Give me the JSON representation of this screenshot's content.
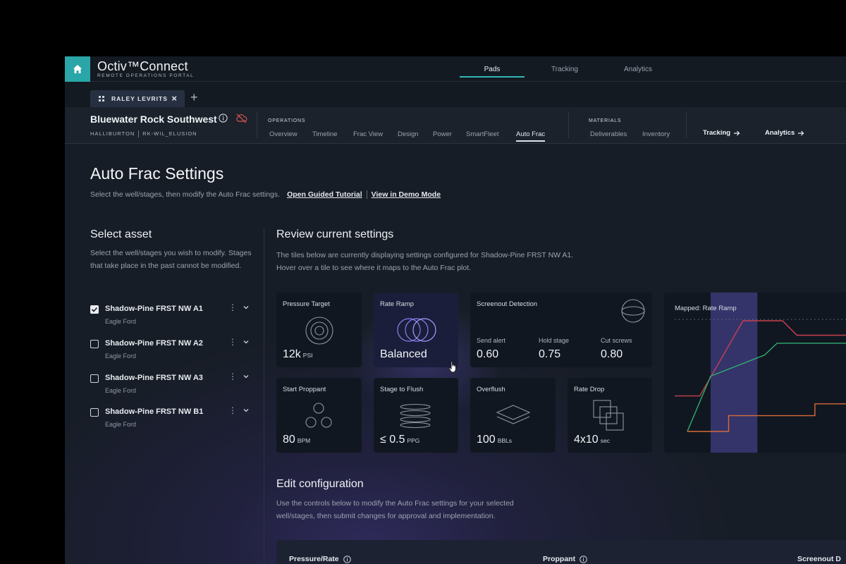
{
  "app": {
    "brand_name": "Octiv™Connect",
    "brand_sub": "REMOTE OPERATIONS PORTAL",
    "nav_tabs": [
      {
        "label": "Pads",
        "active": true
      },
      {
        "label": "Tracking",
        "active": false
      },
      {
        "label": "Analytics",
        "active": false
      }
    ]
  },
  "tabs": {
    "open_tab": "RALEY LEVRITS",
    "new_tab_symbol": "+"
  },
  "context": {
    "site_name": "Bluewater Rock Southwest",
    "company": "HALLIBURTON",
    "site_code": "RK-WIL_ELUSION",
    "operations_label": "OPERATIONS",
    "operations": [
      "Overview",
      "Timeline",
      "Frac View",
      "Design",
      "Power",
      "SmartFleet",
      "Auto Frac"
    ],
    "active_operation": "Auto Frac",
    "materials_label": "MATERIALS",
    "materials": [
      "Deliverables",
      "Inventory"
    ],
    "jump_links": [
      "Tracking",
      "Analytics"
    ]
  },
  "page": {
    "title": "Auto Frac Settings",
    "subtitle": "Select the well/stages, then modify the Auto Frac settings.",
    "link_tutorial": "Open Guided Tutorial",
    "link_demo": "View in Demo Mode"
  },
  "select_asset": {
    "heading": "Select asset",
    "description": "Select the well/stages you wish to modify. Stages that take place in the past cannot be modified.",
    "assets": [
      {
        "name": "Shadow-Pine FRST NW A1",
        "basin": "Eagle Ford",
        "checked": true
      },
      {
        "name": "Shadow-Pine FRST NW A2",
        "basin": "Eagle Ford",
        "checked": false
      },
      {
        "name": "Shadow-Pine FRST NW A3",
        "basin": "Eagle Ford",
        "checked": false
      },
      {
        "name": "Shadow-Pine FRST NW B1",
        "basin": "Eagle Ford",
        "checked": false
      }
    ]
  },
  "review": {
    "heading": "Review current settings",
    "description_line1": "The tiles below are currently displaying settings configured for Shadow-Pine FRST NW A1.",
    "description_line2": "Hover over a tile to see where it maps to the Auto Frac plot.",
    "tiles": {
      "pressure_target": {
        "label": "Pressure Target",
        "value": "12k",
        "unit": "PSI"
      },
      "rate_ramp": {
        "label": "Rate Ramp",
        "value": "Balanced"
      },
      "screenout": {
        "label": "Screenout Detection",
        "items": [
          {
            "label": "Send alert",
            "value": "0.60"
          },
          {
            "label": "Hold stage",
            "value": "0.75"
          },
          {
            "label": "Cut screws",
            "value": "0.80"
          }
        ]
      },
      "start_proppant": {
        "label": "Start Proppant",
        "value": "80",
        "unit": "BPM"
      },
      "stage_to_flush": {
        "label": "Stage to Flush",
        "value": "≤ 0.5",
        "unit": "PPG"
      },
      "overflush": {
        "label": "Overflush",
        "value": "100",
        "unit": "BBLs"
      },
      "rate_drop": {
        "label": "Rate Drop",
        "value": "4x10",
        "unit": "sec"
      }
    }
  },
  "chart_data": {
    "type": "line",
    "title": "Mapped: Rate Ramp",
    "colors": {
      "pressure": "#c8404f",
      "rate": "#2fae70",
      "proppant": "#d86a3a",
      "highlight": "#3b3a78"
    },
    "series": [
      {
        "values": [
          [
            0,
            0.35
          ],
          [
            0.14,
            0.35
          ],
          [
            0.38,
            0.92
          ],
          [
            0.6,
            0.92
          ],
          [
            0.68,
            0.81
          ],
          [
            1,
            0.81
          ]
        ]
      },
      {
        "values": [
          [
            0.07,
            0.08
          ],
          [
            0.2,
            0.5
          ],
          [
            0.5,
            0.66
          ],
          [
            0.57,
            0.75
          ],
          [
            1,
            0.75
          ]
        ]
      },
      {
        "values": [
          [
            0.07,
            0.08
          ],
          [
            0.3,
            0.08
          ],
          [
            0.3,
            0.2
          ],
          [
            0.78,
            0.2
          ],
          [
            0.78,
            0.29
          ],
          [
            1,
            0.29
          ]
        ]
      }
    ],
    "highlight_range": [
      0.2,
      0.46
    ],
    "target_line": 0.93,
    "xlim": [
      0,
      1
    ],
    "ylim": [
      0,
      1
    ]
  },
  "edit": {
    "heading": "Edit configuration",
    "description_line1": "Use the controls below to modify the Auto Frac settings for your selected",
    "description_line2": "well/stages, then submit changes for approval and implementation.",
    "columns": [
      "Pressure/Rate",
      "Proppant",
      "Screenout D"
    ]
  }
}
